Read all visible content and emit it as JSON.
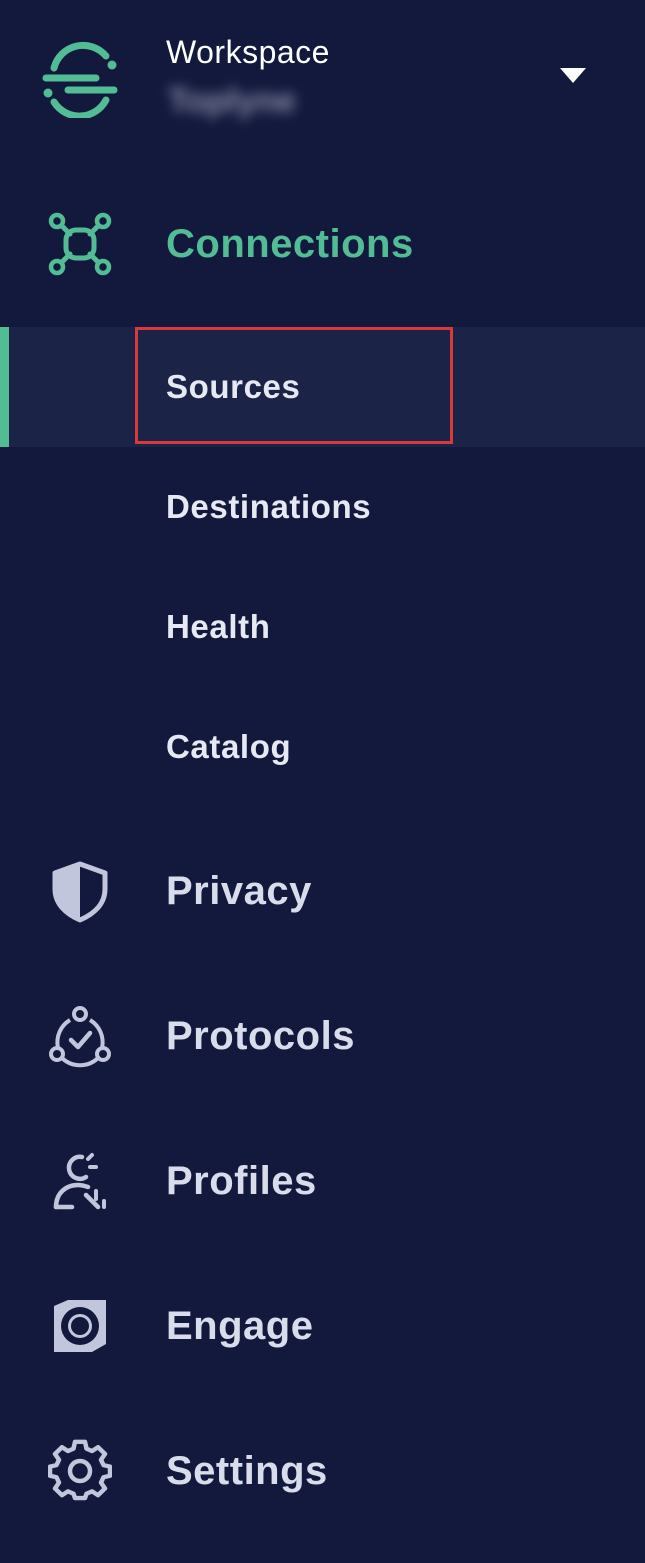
{
  "workspace": {
    "label": "Workspace",
    "name": "Toplyne",
    "dropdown_icon": "caret-down-icon"
  },
  "colors": {
    "background": "#13193d",
    "accent": "#52bd94",
    "selected_row": "#1b2347",
    "highlight": "#d9393b",
    "text": "#d9dcea"
  },
  "nav": {
    "connections": {
      "label": "Connections",
      "icon": "connections-network-icon",
      "active": true,
      "children": [
        {
          "label": "Sources",
          "selected": true
        },
        {
          "label": "Destinations"
        },
        {
          "label": "Health"
        },
        {
          "label": "Catalog"
        }
      ]
    },
    "privacy": {
      "label": "Privacy",
      "icon": "shield-icon"
    },
    "protocols": {
      "label": "Protocols",
      "icon": "protocols-check-icon"
    },
    "profiles": {
      "label": "Profiles",
      "icon": "profiles-person-icon"
    },
    "engage": {
      "label": "Engage",
      "icon": "engage-ring-icon"
    },
    "settings": {
      "label": "Settings",
      "icon": "gear-icon"
    }
  }
}
